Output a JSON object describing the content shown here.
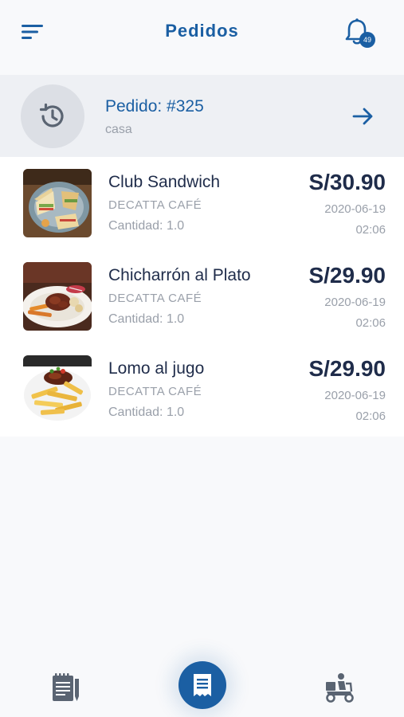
{
  "header": {
    "title": "Pedidos",
    "notification_count": "49",
    "menu_icon": "sort-menu-icon",
    "bell_icon": "bell-icon"
  },
  "order": {
    "label": "Pedido: #325",
    "location": "casa",
    "status_icon": "history-clock-icon",
    "action_icon": "arrow-right-icon"
  },
  "items": [
    {
      "name": "Club Sandwich",
      "store": "DECATTA CAFÉ",
      "quantity": "Cantidad: 1.0",
      "price": "S/30.90",
      "date": "2020-06-19",
      "time": "02:06",
      "image": "club-sandwich-photo"
    },
    {
      "name": "Chicharrón al Plato",
      "store": "DECATTA CAFÉ",
      "quantity": "Cantidad: 1.0",
      "price": "S/29.90",
      "date": "2020-06-19",
      "time": "02:06",
      "image": "chicharron-plate-photo"
    },
    {
      "name": "Lomo al jugo",
      "store": "DECATTA CAFÉ",
      "quantity": "Cantidad: 1.0",
      "price": "S/29.90",
      "date": "2020-06-19",
      "time": "02:06",
      "image": "lomo-fries-photo"
    }
  ],
  "bottom_nav": {
    "left_icon": "menu-notepad-icon",
    "center_icon": "receipt-icon",
    "right_icon": "delivery-scooter-icon"
  },
  "colors": {
    "primary": "#1b5fa3",
    "text_dark": "#1f2c4a",
    "text_muted": "#9aa0aa",
    "summary_bg": "#eef0f4"
  }
}
